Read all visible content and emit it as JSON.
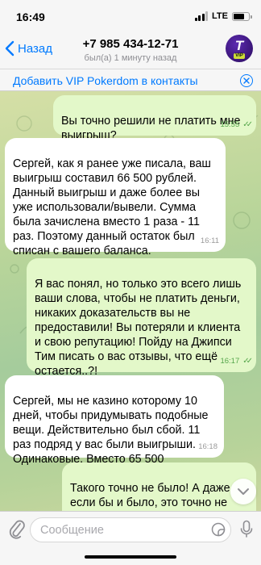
{
  "status_bar": {
    "time": "16:49",
    "network": "LTE",
    "signal_bars_filled": 3,
    "signal_bars_total": 4,
    "battery_level": 0.75
  },
  "header": {
    "back_label": "Назад",
    "title": "+7 985 434-12-71",
    "subtitle": "был(а) 1 минуту назад",
    "avatar_badge": "VIP"
  },
  "add_banner": {
    "label": "Добавить VIP Pokerdom в контакты"
  },
  "messages": [
    {
      "direction": "out",
      "text": "Вы точно решили не платить мне выигрыш?",
      "time": "15:55"
    },
    {
      "direction": "in",
      "text": "Сергей, как я ранее уже писала, ваш выигрыш составил 66 500 рублей. Данный выигрыш и даже более вы уже использовали/вывели. Сумма была зачислена вместо 1 раза - 11 раз. Поэтому данный остаток был списан с вашего баланса.",
      "time": "16:11"
    },
    {
      "direction": "out",
      "text": "Я вас понял, но только это всего лишь ваши слова, чтобы не платить деньги, никаких доказательств вы не предоставили! Вы потеряли и клиента и свою репутацию! Пойду на Джипси Тим писать о вас отзывы, что ещё остается..?!",
      "time": "16:17"
    },
    {
      "direction": "in",
      "text": "Сергей, мы не казино которому 10 дней, чтобы придумывать подобные вещи. Действительно был сбой. 11 раз подряд у вас были выигрыши. Одинаковые. Вместо 65 500",
      "time": "16:18"
    },
    {
      "direction": "out",
      "text": "Такого точно не было! А даже если бы и было, это точно не мои проблемы! Я выиграл в бонусной",
      "time": ""
    }
  ],
  "input": {
    "placeholder": "Сообщение"
  },
  "colors": {
    "accent": "#007aff",
    "outgoing_bubble": "#e3f8c9",
    "incoming_bubble": "#ffffff",
    "read_check": "#55a64b"
  }
}
